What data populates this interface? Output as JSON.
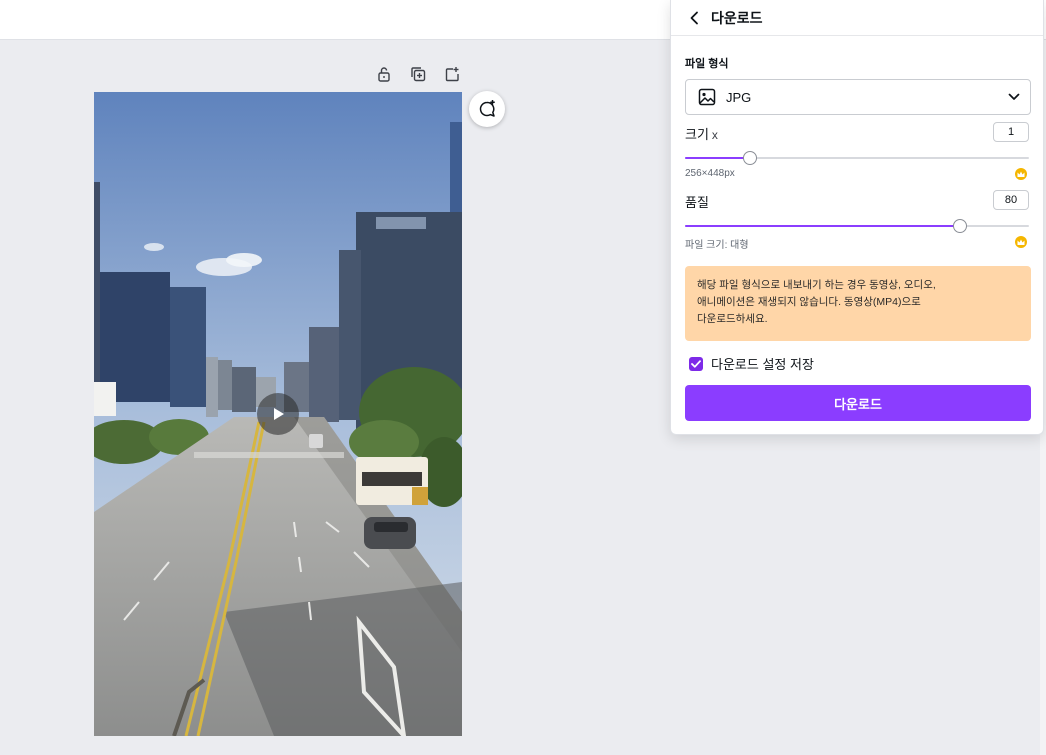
{
  "panel": {
    "title": "다운로드",
    "file_format_label": "파일 형식",
    "file_format_value": "JPG",
    "size_label": "크기",
    "size_suffix": "x",
    "size_value": "1",
    "size_slider_fraction": 0.19,
    "dimensions_text": "256×448px",
    "quality_label": "품질",
    "quality_value": "80",
    "quality_slider_fraction": 0.8,
    "file_size_text": "파일 크기: 대형",
    "warning_line1": "해당 파일 형식으로 내보내기 하는 경우 동영상, 오디오,",
    "warning_line2": "애니메이션은 재생되지 않습니다. 동영상(MP4)으로",
    "warning_line3": "다운로드하세요.",
    "save_settings_label": "다운로드 설정 저장",
    "save_settings_checked": true,
    "download_button_label": "다운로드"
  },
  "colors": {
    "accent": "#8b3dff",
    "checkbox": "#7d2ae8",
    "warning_bg": "#ffd6a8",
    "crown": "#f5b600"
  },
  "icons": {
    "canvas_tools": [
      "lock-icon",
      "duplicate-icon",
      "add-page-icon"
    ],
    "comment": "add-comment-icon",
    "video": "play-icon",
    "back": "chevron-left-icon",
    "format": "image-icon",
    "dropdown": "chevron-down-icon",
    "premium": "crown-icon"
  }
}
